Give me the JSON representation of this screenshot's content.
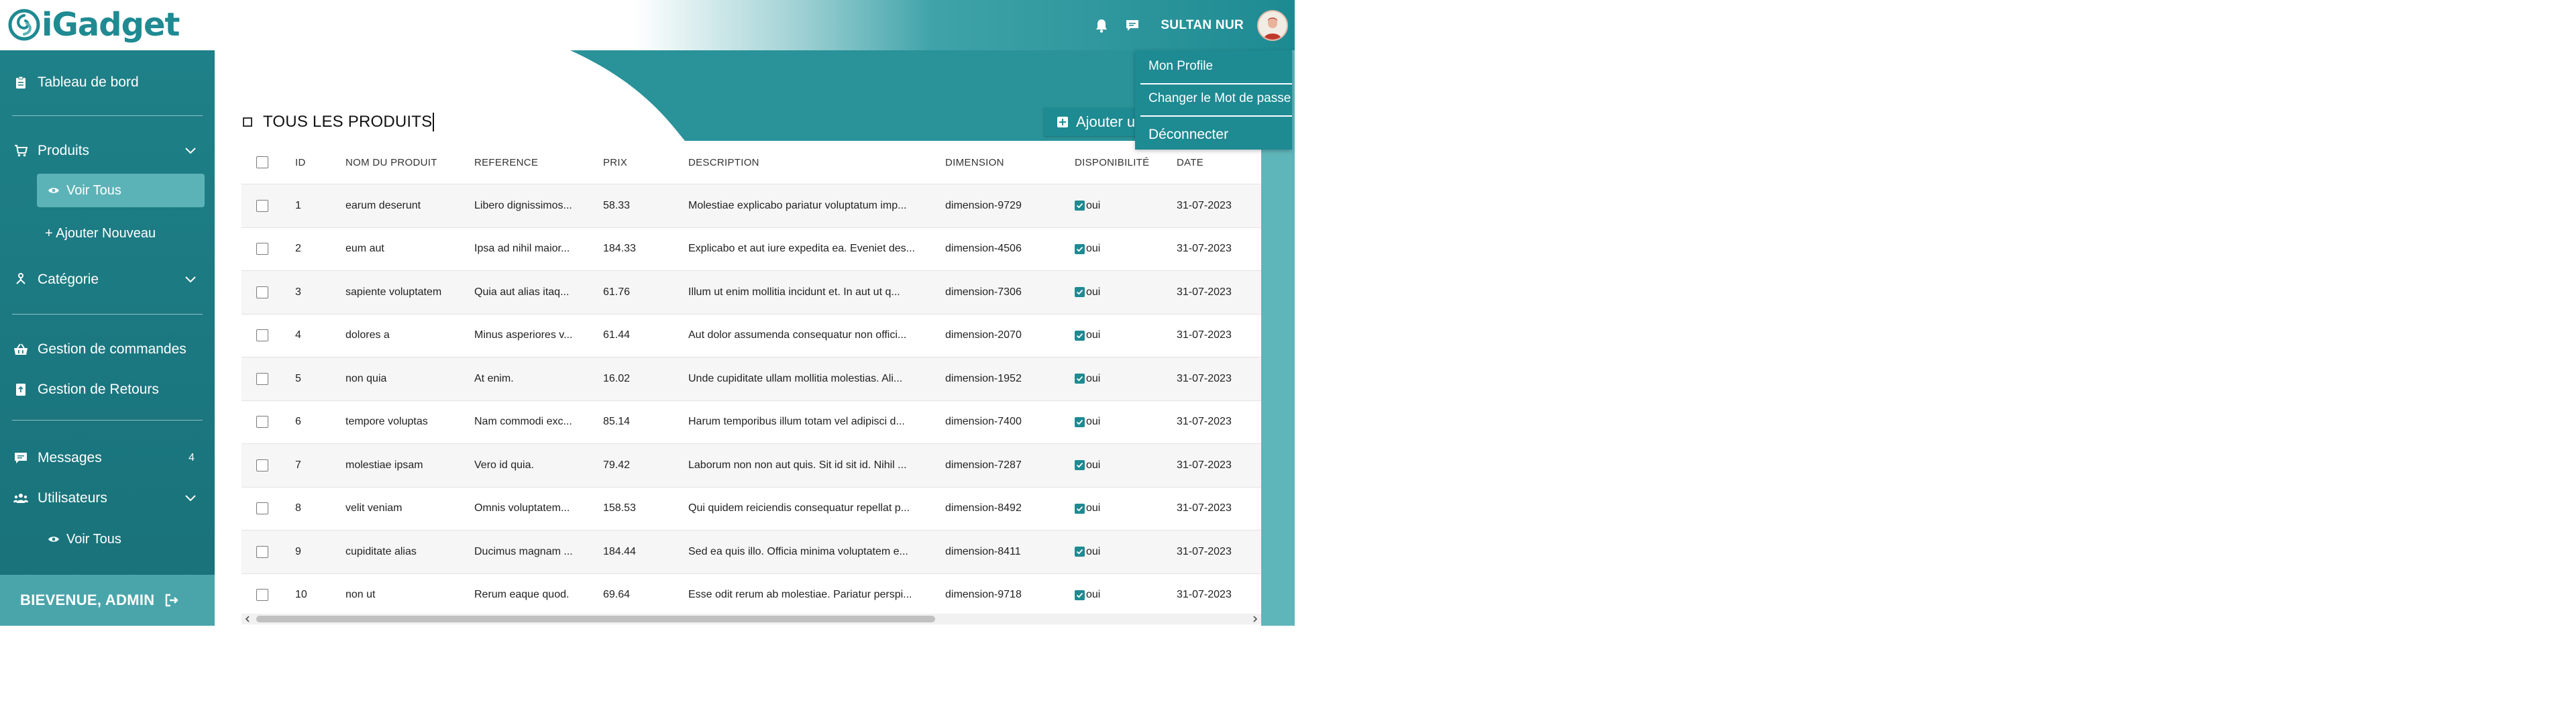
{
  "brand": {
    "name": "iGadget"
  },
  "header": {
    "user_name": "SULTAN NUR"
  },
  "user_menu": {
    "items": [
      "Mon Profile",
      "Changer le Mot de passe",
      "Déconnecter"
    ]
  },
  "sidebar": {
    "dashboard": "Tableau de bord",
    "products": {
      "label": "Produits",
      "view_all": "Voir Tous",
      "add_new": "+ Ajouter Nouveau"
    },
    "category": "Catégorie",
    "orders": "Gestion de commandes",
    "returns": "Gestion de Retours",
    "messages": {
      "label": "Messages",
      "count": "4"
    },
    "users": {
      "label": "Utilisateurs",
      "view_all": "Voir Tous"
    },
    "footer": "BIEVENUE, ADMIN"
  },
  "page": {
    "title": "TOUS LES PRODUITS",
    "add_button": "Ajouter un Produit"
  },
  "table": {
    "columns": [
      "ID",
      "NOM DU PRODUIT",
      "REFERENCE",
      "PRIX",
      "DESCRIPTION",
      "DIMENSION",
      "DISPONIBILITÉ",
      "DATE"
    ],
    "rows": [
      [
        "1",
        "earum deserunt",
        "Libero dignissimos...",
        "58.33",
        "Molestiae explicabo pariatur voluptatum imp...",
        "dimension-9729",
        "oui",
        "31-07-2023"
      ],
      [
        "2",
        "eum aut",
        "Ipsa ad nihil maior...",
        "184.33",
        "Explicabo et aut iure expedita ea. Eveniet des...",
        "dimension-4506",
        "oui",
        "31-07-2023"
      ],
      [
        "3",
        "sapiente voluptatem",
        "Quia aut alias itaq...",
        "61.76",
        "Illum ut enim mollitia incidunt et. In aut ut q...",
        "dimension-7306",
        "oui",
        "31-07-2023"
      ],
      [
        "4",
        "dolores a",
        "Minus asperiores v...",
        "61.44",
        "Aut dolor assumenda consequatur non offici...",
        "dimension-2070",
        "oui",
        "31-07-2023"
      ],
      [
        "5",
        "non quia",
        "At enim.",
        "16.02",
        "Unde cupiditate ullam mollitia molestias. Ali...",
        "dimension-1952",
        "oui",
        "31-07-2023"
      ],
      [
        "6",
        "tempore voluptas",
        "Nam commodi exc...",
        "85.14",
        "Harum temporibus illum totam vel adipisci d...",
        "dimension-7400",
        "oui",
        "31-07-2023"
      ],
      [
        "7",
        "molestiae ipsam",
        "Vero id quia.",
        "79.42",
        "Laborum non non aut quis. Sit id sit id. Nihil ...",
        "dimension-7287",
        "oui",
        "31-07-2023"
      ],
      [
        "8",
        "velit veniam",
        "Omnis voluptatem...",
        "158.53",
        "Qui quidem reiciendis consequatur repellat p...",
        "dimension-8492",
        "oui",
        "31-07-2023"
      ],
      [
        "9",
        "cupiditate alias",
        "Ducimus magnam ...",
        "184.44",
        "Sed ea quis illo. Officia minima voluptatem e...",
        "dimension-8411",
        "oui",
        "31-07-2023"
      ],
      [
        "10",
        "non ut",
        "Rerum eaque quod.",
        "69.64",
        "Esse odit rerum ab molestiae. Pariatur perspi...",
        "dimension-9718",
        "oui",
        "31-07-2023"
      ]
    ]
  },
  "colors": {
    "brand": "#1e8a92",
    "sidebar": "#1e8088",
    "active_item": "#5cb3b7",
    "footer": "#4aa5ab"
  },
  "icons": {
    "header": [
      "bell-icon",
      "chat-icon"
    ],
    "sidebar": [
      "clipboard-icon",
      "cart-icon",
      "eye-icon",
      "hierarchy-icon",
      "basket-icon",
      "return-box-icon",
      "message-icon",
      "users-icon",
      "logout-icon"
    ]
  }
}
